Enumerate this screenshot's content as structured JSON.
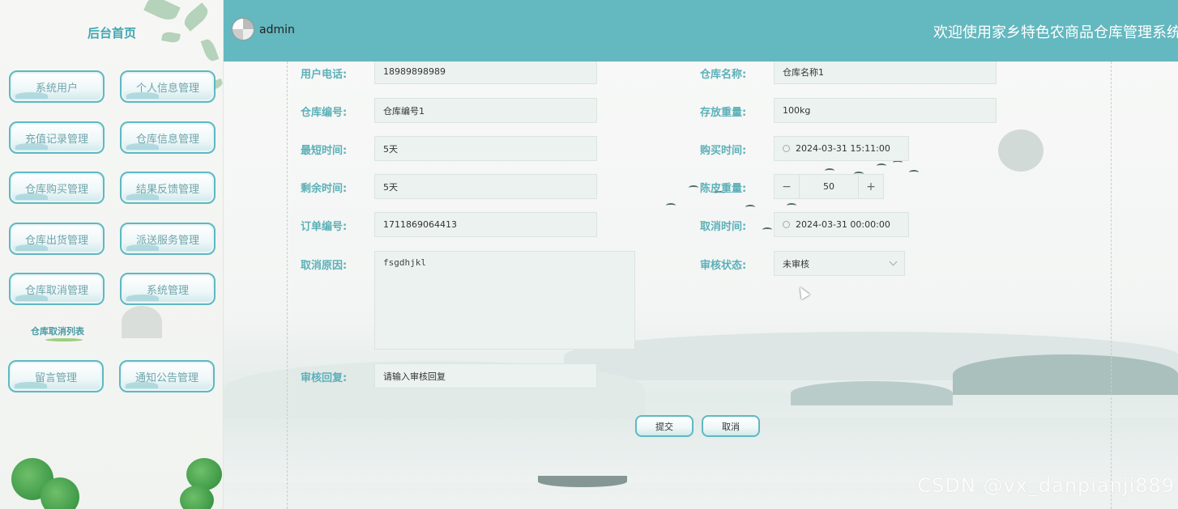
{
  "sidebar": {
    "title": "后台首页",
    "menu": [
      {
        "label": "系统用户"
      },
      {
        "label": "个人信息管理"
      },
      {
        "label": "充值记录管理"
      },
      {
        "label": "仓库信息管理"
      },
      {
        "label": "仓库购买管理"
      },
      {
        "label": "结果反馈管理"
      },
      {
        "label": "仓库出货管理"
      },
      {
        "label": "派送服务管理"
      },
      {
        "label": "仓库取消管理"
      },
      {
        "label": "系统管理"
      },
      {
        "label": "留言管理"
      },
      {
        "label": "通知公告管理"
      }
    ],
    "active_sub_item": "仓库取消列表"
  },
  "header": {
    "username": "admin",
    "welcome": "欢迎使用家乡特色农商品仓库管理系统"
  },
  "form": {
    "phone_label": "用户电话:",
    "phone_value": "18989898989",
    "warehouse_name_label": "仓库名称:",
    "warehouse_name_value": "仓库名称1",
    "warehouse_no_label": "仓库编号:",
    "warehouse_no_value": "仓库编号1",
    "storage_weight_label": "存放重量:",
    "storage_weight_value": "100kg",
    "min_time_label": "最短时间:",
    "min_time_value": "5天",
    "purchase_time_label": "购买时间:",
    "purchase_time_value": "2024-03-31 15:11:00",
    "remaining_time_label": "剩余时间:",
    "remaining_time_value": "5天",
    "tare_weight_label": "陈皮重量:",
    "tare_weight_value": "50",
    "order_no_label": "订单编号:",
    "order_no_value": "1711869064413",
    "cancel_time_label": "取消时间:",
    "cancel_time_value": "2024-03-31 00:00:00",
    "cancel_reason_label": "取消原因:",
    "cancel_reason_value": "fsgdhjkl",
    "review_status_label": "审核状态:",
    "review_status_value": "未审核",
    "review_reply_label": "审核回复:",
    "review_reply_placeholder": "请输入审核回复",
    "submit_label": "提交",
    "cancel_label": "取消"
  },
  "stepper": {
    "minus": "−",
    "plus": "+"
  },
  "watermark": "CSDN @vx_danpianji889",
  "colors": {
    "header": "#64b8bf",
    "accent": "#5cb0b8",
    "field_bg": "#ebf2f0"
  }
}
